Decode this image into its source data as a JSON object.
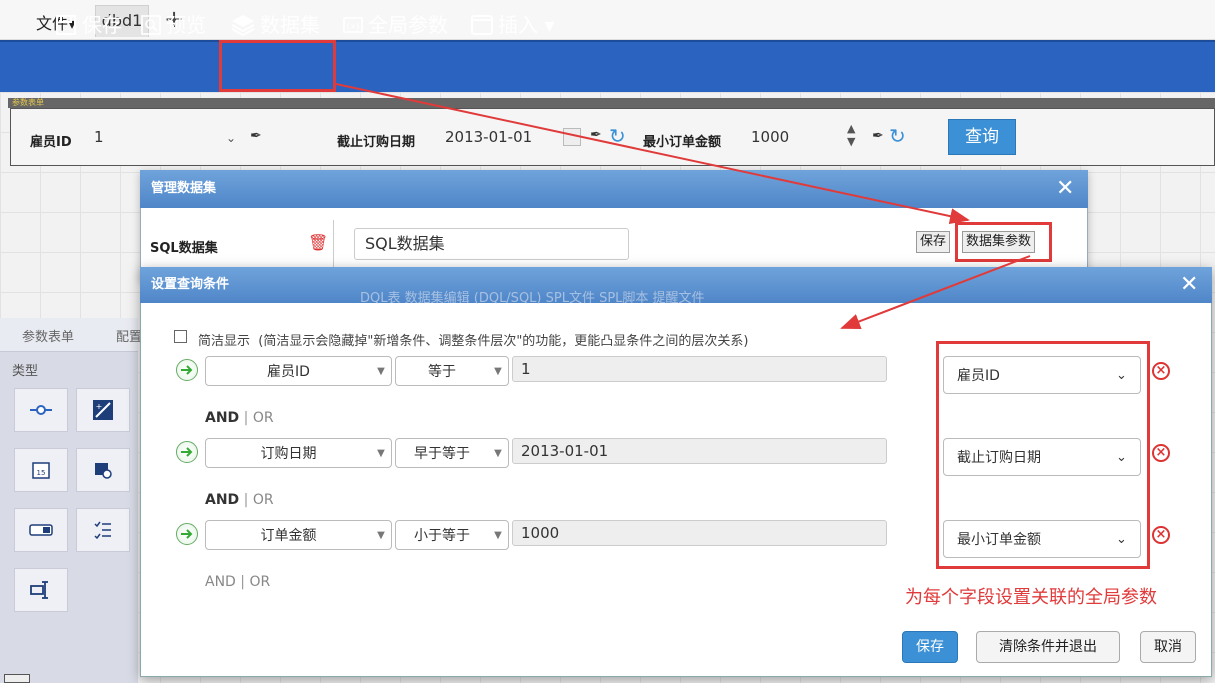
{
  "tabs": {
    "file_menu": "文件▾",
    "active_tab": "dbd1",
    "add_tab": "+"
  },
  "toolbar": {
    "save": "保存",
    "preview": "预览",
    "dataset": "数据集",
    "global_params": "全局参数",
    "insert": "插入 ▾"
  },
  "param_form": {
    "strip_label": "参数表单",
    "employee_label": "雇员ID",
    "employee_value": "1",
    "date_label": "截止订购日期",
    "date_value": "2013-01-01",
    "amount_label": "最小订单金额",
    "amount_value": "1000",
    "query_button": "查询"
  },
  "side_panel": {
    "tab1": "参数表单",
    "tab2": "配置",
    "type_label": "类型"
  },
  "manage_dialog": {
    "title": "管理数据集",
    "dataset_label": "SQL数据集",
    "dataset_name": "SQL数据集",
    "save_button": "保存",
    "params_button": "数据集参数",
    "faded_tabs": "DQL表    数据集编辑 (DQL/SQL)    SPL文件    SPL脚本    提醒文件"
  },
  "query_dialog": {
    "title": "设置查询条件",
    "simple_label": "简洁显示",
    "simple_note": "(简洁显示会隐藏掉\"新增条件、调整条件层次\"的功能，更能凸显条件之间的层次关系)",
    "conditions": [
      {
        "field": "雇员ID",
        "op": "等于",
        "value": "1",
        "param": "雇员ID"
      },
      {
        "field": "订购日期",
        "op": "早于等于",
        "value": "2013-01-01",
        "param": "截止订购日期"
      },
      {
        "field": "订单金额",
        "op": "小于等于",
        "value": "1000",
        "param": "最小订单金额"
      }
    ],
    "and": "AND",
    "sep": "|",
    "or": "OR",
    "annotation": "为每个字段设置关联的全局参数",
    "save_button": "保存",
    "clear_button": "清除条件并退出",
    "cancel_button": "取消"
  },
  "colors": {
    "toolbar": "#2b64c0",
    "highlight": "#e03a3a",
    "primary": "#3c91d6"
  }
}
